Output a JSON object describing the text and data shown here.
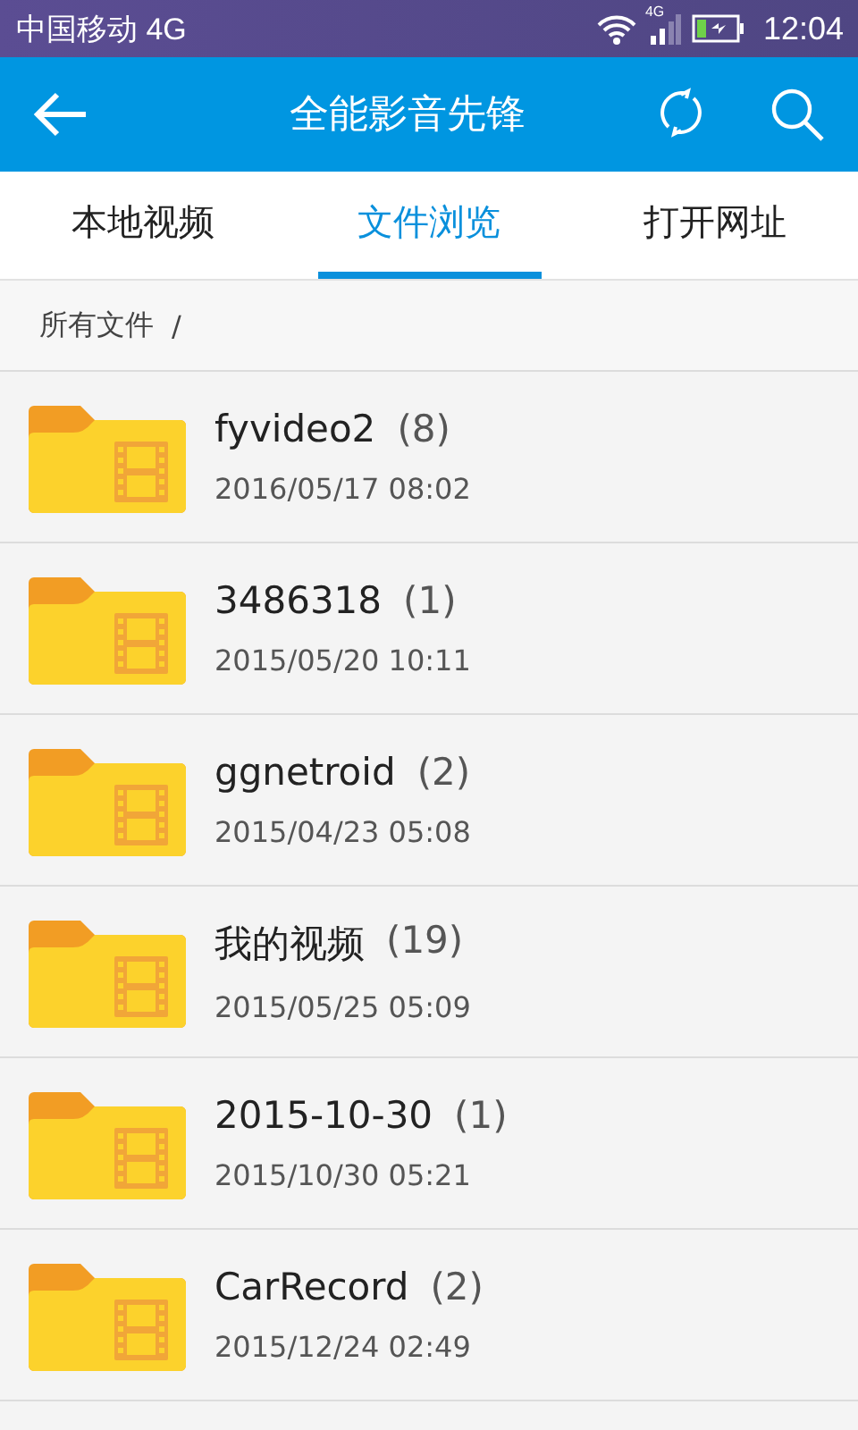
{
  "status_bar": {
    "carrier": "中国移动 4G",
    "network_badge": "4G",
    "time": "12:04"
  },
  "header": {
    "title": "全能影音先锋"
  },
  "tabs": [
    {
      "label": "本地视频",
      "selected": false
    },
    {
      "label": "文件浏览",
      "selected": true
    },
    {
      "label": "打开网址",
      "selected": false
    }
  ],
  "breadcrumb": {
    "path": "所有文件",
    "separator": "/"
  },
  "folders": [
    {
      "name": "fyvideo2",
      "count": "(8)",
      "date": "2016/05/17 08:02"
    },
    {
      "name": "3486318",
      "count": "(1)",
      "date": "2015/05/20 10:11"
    },
    {
      "name": "ggnetroid",
      "count": "(2)",
      "date": "2015/04/23 05:08"
    },
    {
      "name": "我的视频",
      "count": "(19)",
      "date": "2015/05/25 05:09"
    },
    {
      "name": "2015-10-30",
      "count": "(1)",
      "date": "2015/10/30 05:21"
    },
    {
      "name": "CarRecord",
      "count": "(2)",
      "date": "2015/12/24 02:49"
    }
  ]
}
